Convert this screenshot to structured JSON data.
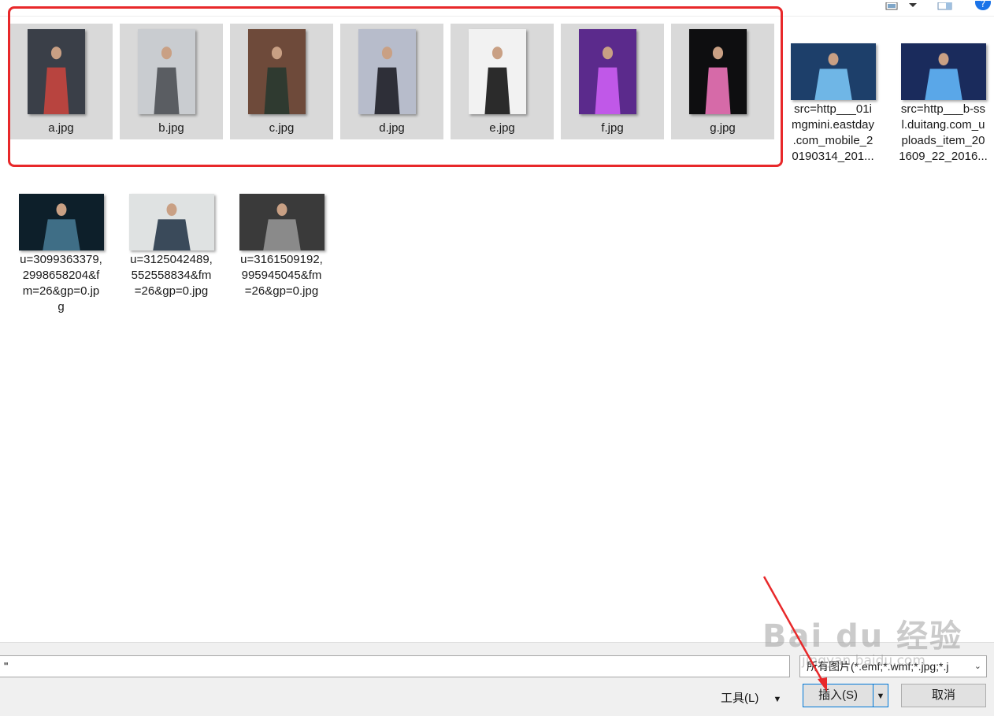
{
  "files_row1": [
    {
      "name": "a.jpg",
      "selected": true,
      "bg": "#3a3f48",
      "fg": "#b8443f"
    },
    {
      "name": "b.jpg",
      "selected": true,
      "bg": "#c9ccd0",
      "fg": "#5a5d62"
    },
    {
      "name": "c.jpg",
      "selected": true,
      "bg": "#6e4a3a",
      "fg": "#2f3a30"
    },
    {
      "name": "d.jpg",
      "selected": true,
      "bg": "#b7bccb",
      "fg": "#2e2f38"
    },
    {
      "name": "e.jpg",
      "selected": true,
      "bg": "#f2f2f2",
      "fg": "#2b2b2b"
    },
    {
      "name": "f.jpg",
      "selected": true,
      "bg": "#5b2a8c",
      "fg": "#c058e8"
    },
    {
      "name": "g.jpg",
      "selected": true,
      "bg": "#0e0e10",
      "fg": "#d66aa8"
    }
  ],
  "files_row1_extra": [
    {
      "name": "src=http___01i\nmgmini.eastday\n.com_mobile_2\n0190314_201...",
      "bg": "#1d3f6a",
      "fg": "#6fb6e6"
    },
    {
      "name": "src=http___b-ss\nl.duitang.com_u\nploads_item_20\n1609_22_2016...",
      "bg": "#1a2b5c",
      "fg": "#5aa7e8"
    }
  ],
  "files_row2": [
    {
      "name": "u=3099363379,\n2998658204&f\nm=26&gp=0.jp\ng",
      "bg": "#0d1f2a",
      "fg": "#3f6e86"
    },
    {
      "name": "u=3125042489,\n552558834&fm\n=26&gp=0.jpg",
      "bg": "#dfe2e2",
      "fg": "#3a4a5a"
    },
    {
      "name": "u=3161509192,\n995945045&fm\n=26&gp=0.jpg",
      "bg": "#3a3a3a",
      "fg": "#8a8a8a"
    }
  ],
  "bottom": {
    "filename_value": "\"",
    "filetype_label": "所有图片(*.emf;*.wmf;*.jpg;*.j",
    "tools_label": "工具(L)",
    "insert_label": "插入(S)",
    "cancel_label": "取消"
  },
  "watermark": {
    "text": "Bai du 经验",
    "url": "jingyan.baidu.com"
  },
  "colors": {
    "selection_border": "#e8282a",
    "tile_selected_bg": "#d9d9d9",
    "primary_border": "#0078d7"
  }
}
